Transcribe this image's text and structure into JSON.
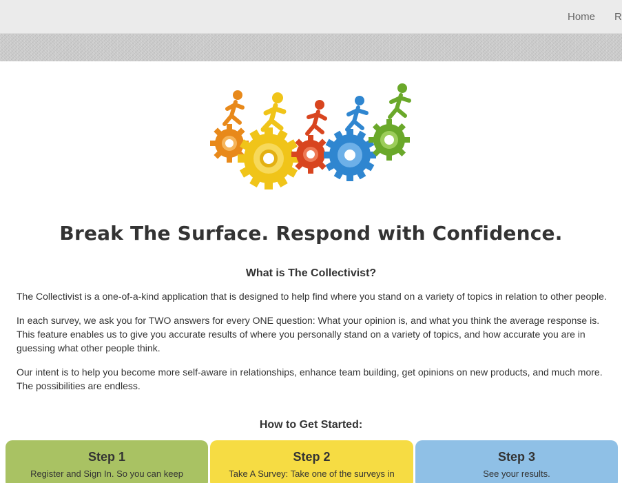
{
  "nav": {
    "items": [
      {
        "label": "Home"
      },
      {
        "label": "Re"
      }
    ]
  },
  "hero": {
    "illustration_icon": "people-on-gears-icon",
    "headline": "Break The Surface. Respond with Confidence."
  },
  "about": {
    "heading": "What is The Collectivist?",
    "paragraphs": [
      "The Collectivist is a one-of-a-kind application that is designed to help find where you stand on a variety of topics in relation to other people.",
      "In each survey, we ask you for TWO answers for every ONE question: What your opinion is, and what you think the average response is. This feature enables us to give you accurate results of where you personally stand on a variety of topics, and how accurate you are in guessing what other people think.",
      "Our intent is to help you become more self-aware in relationships, enhance team building, get opinions on new products, and much more. The possibilities are endless."
    ]
  },
  "getting_started": {
    "heading": "How to Get Started:",
    "steps": [
      {
        "title": "Step 1",
        "desc": "Register and Sign In. So you can keep",
        "color": "#a9c263"
      },
      {
        "title": "Step 2",
        "desc": "Take A Survey: Take one of the surveys in",
        "color": "#f6dc43"
      },
      {
        "title": "Step 3",
        "desc": "See your results.",
        "color": "#8fc0e6"
      }
    ]
  },
  "colors": {
    "orange": "#e8891a",
    "yellow": "#f0c419",
    "red": "#d8451f",
    "blue": "#2f86d0",
    "green": "#6aa82a"
  }
}
